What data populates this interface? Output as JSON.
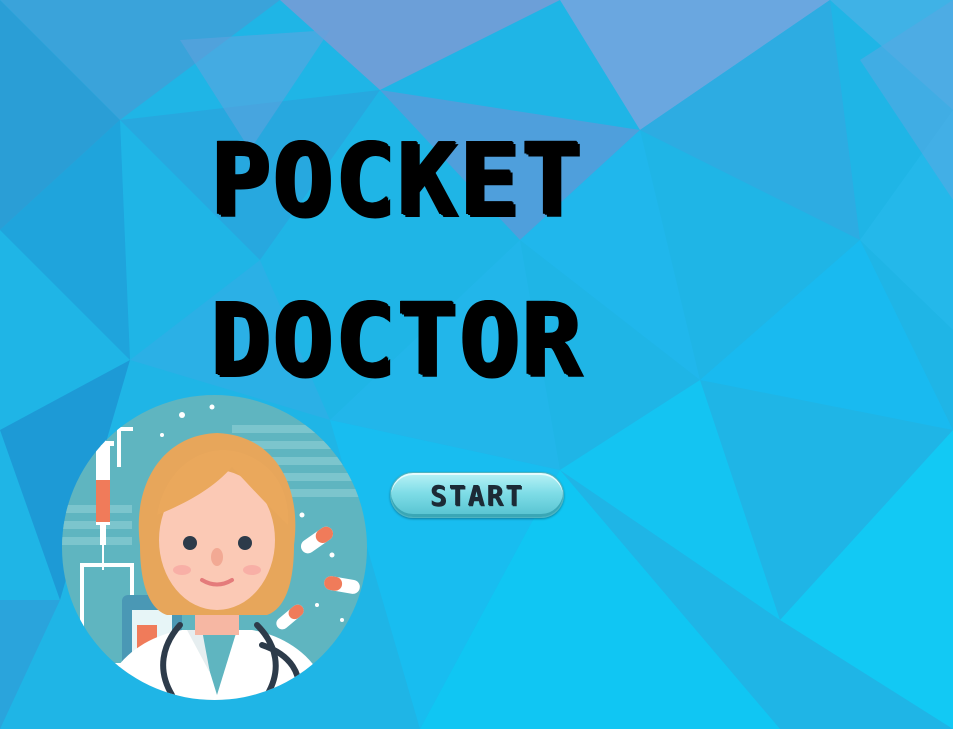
{
  "game": {
    "title_line_1": "POCKET",
    "title_line_2": "DOCTOR",
    "start_label": "START"
  },
  "colors": {
    "background_primary": "#1fb5e6",
    "background_secondary": "#5a9bd8",
    "title": "#000000",
    "button_top": "#b9f2f6",
    "button_bottom": "#55c2d0",
    "avatar_bg": "#5fb5c0"
  },
  "icons": {
    "avatar": "doctor-avatar-icon",
    "syringe": "syringe-icon",
    "pills": "pill-icon",
    "stethoscope": "stethoscope-icon"
  }
}
